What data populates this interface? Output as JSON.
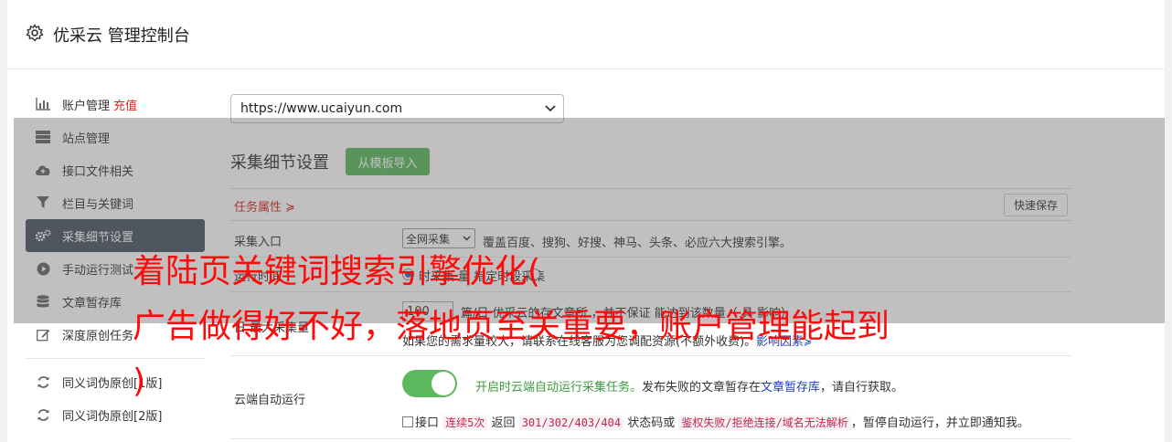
{
  "header": {
    "title": "优采云 管理控制台"
  },
  "sidebar": {
    "items": [
      {
        "label": "账户管理",
        "badge": "充值"
      },
      {
        "label": "站点管理"
      },
      {
        "label": "接口文件相关"
      },
      {
        "label": "栏目与关键词"
      },
      {
        "label": "采集细节设置"
      },
      {
        "label": "手动运行测试"
      },
      {
        "label": "文章暂存库"
      },
      {
        "label": "深度原创任务"
      },
      {
        "label": "同义词伪原创[1版]"
      },
      {
        "label": "同义词伪原创[2版]"
      }
    ]
  },
  "main": {
    "site_url": "https://www.ucaiyun.com",
    "section_title": "采集细节设置",
    "import_btn": "从模板导入",
    "task_attr": "任务属性 ≽",
    "quick_save": "快速保存",
    "entry_label": "采集入口",
    "entry_value": "全网采集",
    "entry_desc": "覆盖百度、搜狗、好搜、神马、头条、必应六大搜索引擎。",
    "runtime_label": "运行时间",
    "runtime_desc": "时采集 量 指定时段采集",
    "count_label": "日 最大采集量",
    "count_value": "100",
    "count_desc_a": "篇/日 优采云的存文章所 ，并不保证 能达到该数量（ 具 影响）",
    "count_desc_b": "如果您的需求量较大，请联系在线客服为您调配资源(不额外收费)。",
    "count_link": "影响因素",
    "cloud_label": "云端自动运行",
    "cloud_desc_pre": "开启时云端自动运行采集任务。",
    "cloud_desc_mid": "发布失败的文章暂存在",
    "cloud_link": "文章暂存库",
    "cloud_desc_post": "，请自行获取。",
    "iface_pre": "接口",
    "iface_code1": "连续5次",
    "iface_mid1": "返回",
    "iface_code2": "301/302/403/404",
    "iface_mid2": "状态码或",
    "iface_code3": "鉴权失败/拒绝连接/域名无法解析",
    "iface_post": "，暂停自动运行，并立即通知我。"
  },
  "overlay": {
    "line1": "着陆页关键词搜索引擎优化(",
    "line2": "广告做得好不好，落地页至关重要，账户管理能起到",
    "line3": ")"
  }
}
